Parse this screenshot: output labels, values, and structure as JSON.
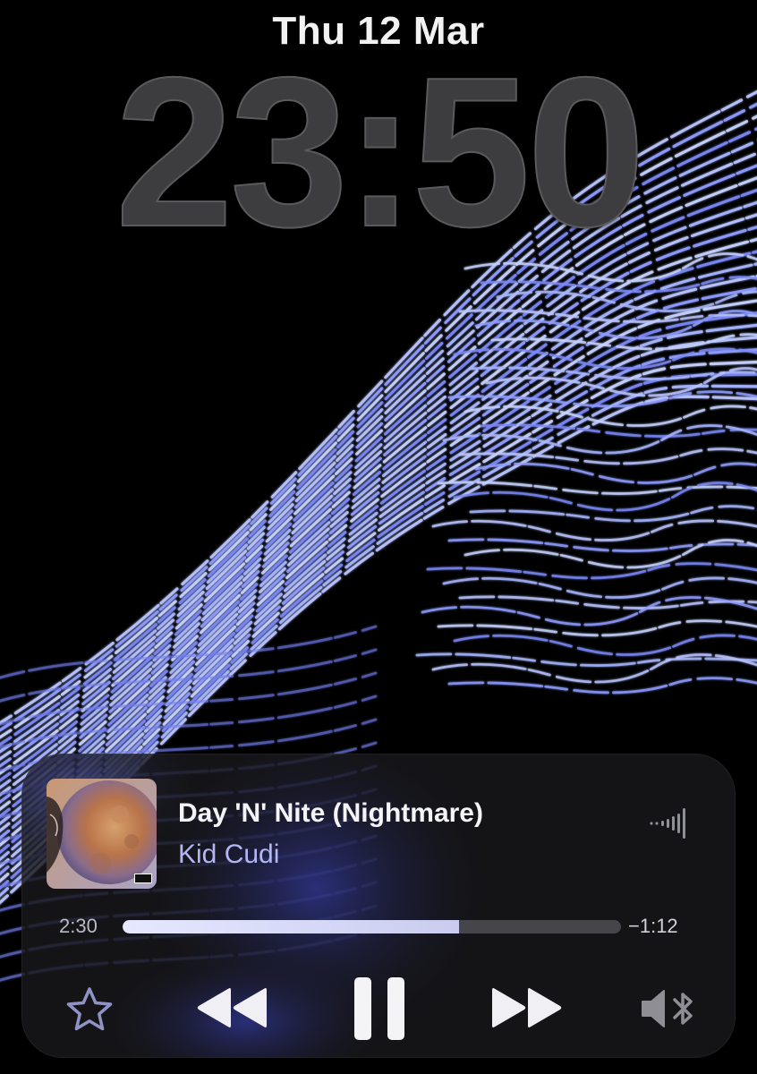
{
  "lockscreen": {
    "date": "Thu 12 Mar",
    "time": "23:50"
  },
  "now_playing": {
    "title": "Day 'N' Nite (Nightmare)",
    "artist": "Kid Cudi",
    "elapsed": "2:30",
    "remaining": "−1:12",
    "progress_fraction": 0.675,
    "accent_color": "#b3b6f5",
    "controls": {
      "favorite": "star-icon",
      "previous": "rewind-icon",
      "play_pause": "pause-icon",
      "next": "fast-forward-icon",
      "output": "speaker-bluetooth-icon"
    }
  }
}
